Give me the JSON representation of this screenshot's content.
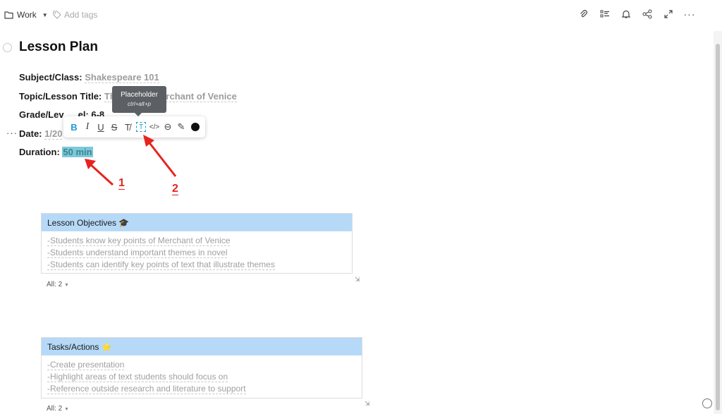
{
  "topbar": {
    "folder": "Work",
    "tags_placeholder": "Add tags",
    "icons": [
      "paperclip-icon",
      "checklist-icon",
      "bell-icon",
      "share-icon",
      "expand-icon",
      "more-icon"
    ]
  },
  "page": {
    "title": "Lesson Plan"
  },
  "fields": [
    {
      "label": "Subject/Class:",
      "value": "Shakespeare 101"
    },
    {
      "label": "Topic/Lesson Title:",
      "value_start": "Th",
      "value_end": "rchant of Venice"
    },
    {
      "label": "Grade/Lev",
      "value_end": "el: 6-8"
    },
    {
      "label": "Date:",
      "value": "1/20"
    },
    {
      "label": "Duration:",
      "value": "50 min"
    }
  ],
  "tooltip": {
    "title": "Placeholder",
    "shortcut": "ctrl+alt+p"
  },
  "toolbar": {
    "bold": "B",
    "italic": "I",
    "underline": "U",
    "strike": "S",
    "clear": "T̸",
    "placeholder": "T",
    "code": "</>",
    "link": "⊖",
    "highlight": "✎"
  },
  "annotations": [
    "1",
    "2"
  ],
  "tables": [
    {
      "header": "Lesson Objectives 🎓",
      "rows": [
        "-Students know key points of Merchant of Venice",
        "-Students understand important themes in novel",
        "-Students can identify key points of text that illustrate themes"
      ],
      "footer": "All: 2"
    },
    {
      "header": "Tasks/Actions ⭐",
      "rows": [
        "-Create presentation",
        "-Highlight areas of text students should focus on",
        "-Reference outside research and literature to support"
      ],
      "footer": "All: 2"
    }
  ],
  "colors": {
    "accent": "#1f9bd0",
    "table_header": "#b6d9f7",
    "highlight": "#7ec8d9",
    "arrow": "#e8231f"
  }
}
